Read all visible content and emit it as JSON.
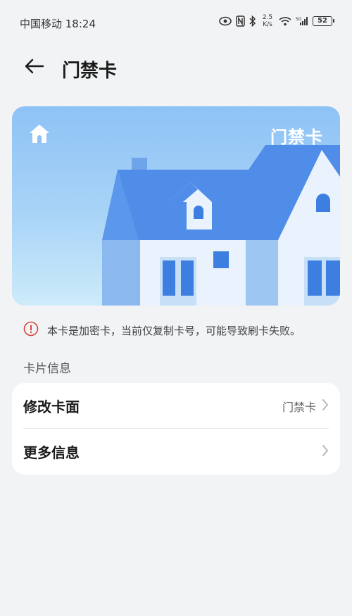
{
  "status_bar": {
    "carrier_time": "中国移动 18:24",
    "net_speed_value": "2.5",
    "net_speed_unit": "K/s",
    "battery": "52"
  },
  "header": {
    "title": "门禁卡"
  },
  "card": {
    "name": "门禁卡"
  },
  "warning": {
    "text": "本卡是加密卡，当前仅复制卡号，可能导致刷卡失败。"
  },
  "section": {
    "title": "卡片信息"
  },
  "list": {
    "items": [
      {
        "label": "修改卡面",
        "value": "门禁卡"
      },
      {
        "label": "更多信息",
        "value": ""
      }
    ]
  }
}
